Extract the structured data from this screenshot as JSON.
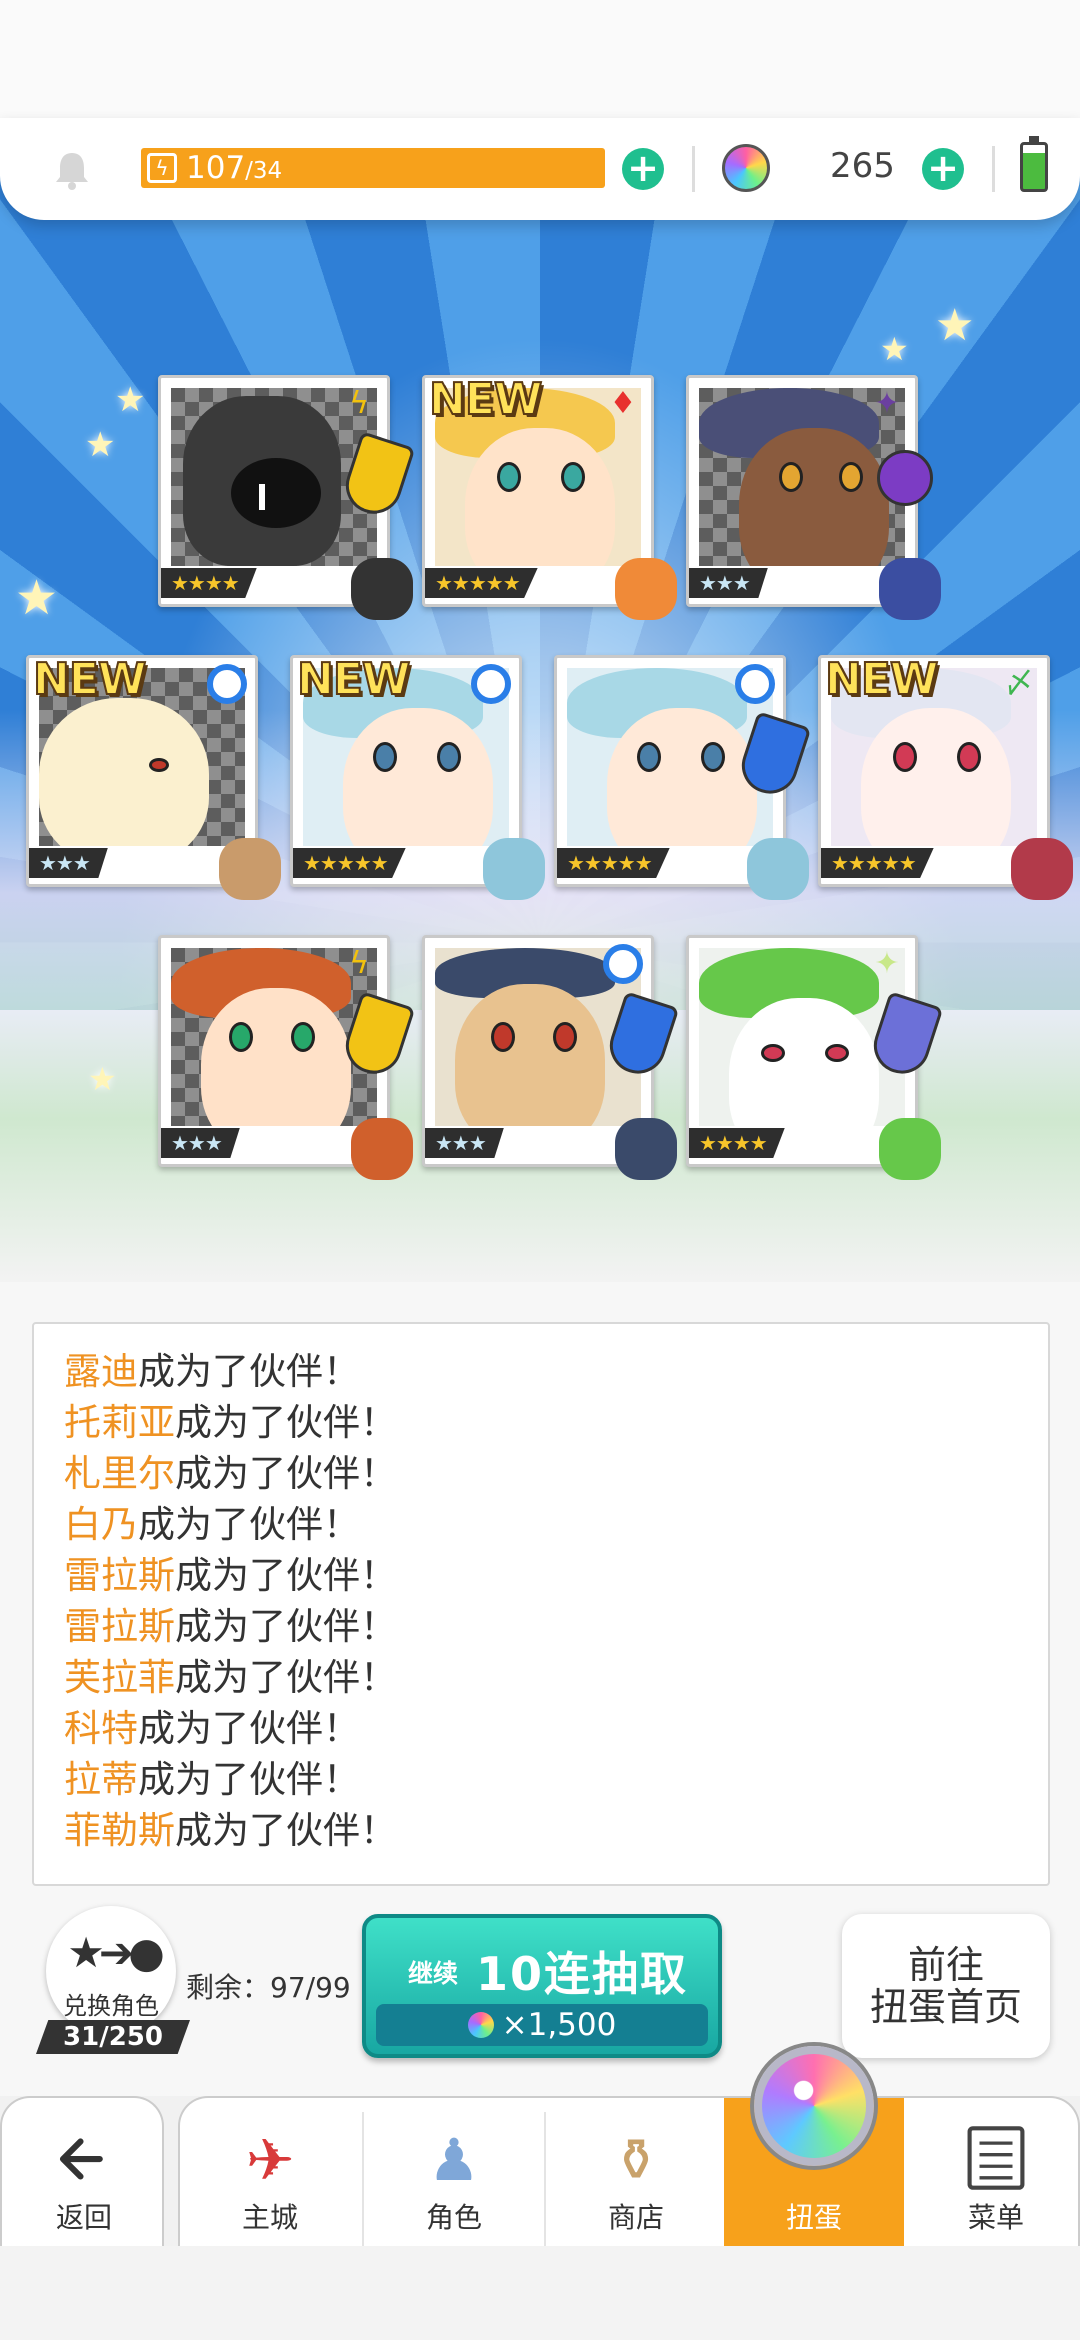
{
  "colors": {
    "accent_orange": "#f7a11b",
    "name_orange": "#ef9222",
    "teal_button": "#18a7a2",
    "plus_green": "#1fbf8f"
  },
  "resources": {
    "energy_current": "107",
    "energy_max": "/34",
    "gems": "265"
  },
  "cards": [
    {
      "rarity": "★★★★",
      "new": false,
      "attribute": "thunder-icon"
    },
    {
      "rarity": "★★★★★",
      "new": true,
      "attribute": "fire-icon"
    },
    {
      "rarity": "★★★",
      "new": false,
      "attribute": "dark-icon"
    },
    {
      "rarity": "★★★",
      "new": true,
      "attribute": "water-icon"
    },
    {
      "rarity": "★★★★★",
      "new": true,
      "attribute": "water-icon"
    },
    {
      "rarity": "★★★★★",
      "new": false,
      "attribute": "water-icon"
    },
    {
      "rarity": "★★★★★",
      "new": true,
      "attribute": "wind-icon"
    },
    {
      "rarity": "★★★",
      "new": false,
      "attribute": "thunder-icon"
    },
    {
      "rarity": "★★★",
      "new": false,
      "attribute": "water-icon"
    },
    {
      "rarity": "★★★★",
      "new": false,
      "attribute": "light-icon"
    }
  ],
  "new_label": "NEW",
  "log": {
    "suffix": "成为了伙伴！",
    "names": [
      "露迪",
      "托莉亚",
      "札里尔",
      "白乃",
      "雷拉斯",
      "雷拉斯",
      "芙拉菲",
      "科特",
      "拉蒂",
      "菲勒斯"
    ]
  },
  "exchange": {
    "label": "兑换角色",
    "count": "31/250",
    "remaining": "剩余：97/99"
  },
  "pull_button": {
    "continue": "继续",
    "title": "10连抽取",
    "cost": "×1,500"
  },
  "home_button": {
    "line1": "前往",
    "line2": "扭蛋首页"
  },
  "nav": {
    "back": "返回",
    "items": [
      "主城",
      "角色",
      "商店",
      "扭蛋",
      "菜单"
    ]
  }
}
